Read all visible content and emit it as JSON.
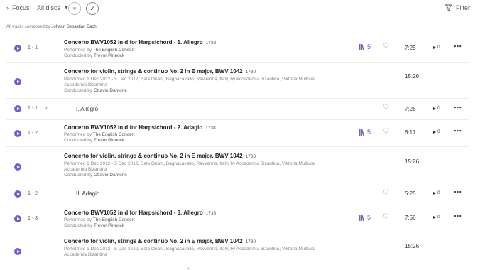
{
  "toolbar": {
    "focus_label": "Focus",
    "discs_label": "All discs",
    "filter_label": "Filter"
  },
  "composer_line": {
    "prefix": "All tracks composed by",
    "name": "Johann Sebastian Bach"
  },
  "tracks": [
    {
      "num": "1 - 1",
      "title": "Concerto BWV1052 in d for Harpsichord - 1. Allegro",
      "year": "1738",
      "performed_prefix": "Performed by",
      "performed": "The English Concert",
      "conducted_prefix": "Conducted by",
      "conducted": "Trevor Pinnock",
      "versions": "5",
      "duration": "7:25",
      "plays": "0"
    },
    {
      "title": "Concerto for violin, strings & continuo No. 2 in E major, BWV 1042",
      "year": "1730",
      "performed_line1": "Performed 1 Dec 2012 - 5 Dec 2012, Sala Oriani, Bagnacavallo, Ravvenna, Italy, by Accademia Bizantina, Viktoria Mullova,",
      "performed_line2": "Accademia Bizantina",
      "conducted_prefix": "Conducted by",
      "conducted": "Ottavio Dantone",
      "duration": "15:26"
    },
    {
      "num": "1 - 1",
      "check": "✓",
      "title": "I. Allegro",
      "duration": "7:26",
      "plays": "0"
    },
    {
      "num": "1 - 2",
      "title": "Concerto BWV1052 in d for Harpsichord - 2. Adagio",
      "year": "1738",
      "performed_prefix": "Performed by",
      "performed": "The English Concert",
      "conducted_prefix": "Conducted by",
      "conducted": "Trevor Pinnock",
      "versions": "5",
      "duration": "6:17",
      "plays": "0"
    },
    {
      "title": "Concerto for violin, strings & continuo No. 2 in E major, BWV 1042",
      "year": "1730",
      "performed_line1": "Performed 1 Dec 2012 - 5 Dec 2012, Sala Oriani, Bagnacavallo, Ravvenna, Italy, by Accademia Bizantina, Viktoria Mullova,",
      "performed_line2": "Accademia Bizantina",
      "conducted_prefix": "Conducted by",
      "conducted": "Ottavio Dantone",
      "duration": "15:26"
    },
    {
      "num": "1 - 2",
      "title": "II. Adagio",
      "duration": "5:25",
      "plays": "0"
    },
    {
      "num": "1 - 3",
      "title": "Concerto BWV1052 in d for Harpsichord - 3. Allegro",
      "year": "1738",
      "performed_prefix": "Performed by",
      "performed": "The English Concert",
      "conducted_prefix": "Conducted by",
      "conducted": "Trevor Pinnock",
      "versions": "5",
      "duration": "7:56",
      "plays": "0"
    },
    {
      "title": "Concerto for violin, strings & continuo No. 2 in E major, BWV 1042",
      "year": "1730",
      "performed_line1": "Performed 1 Dec 2012 - 5 Dec 2012, Sala Oriani, Bagnacavallo, Ravvenna, Italy, by Accademia Bizantina, Viktoria Mullova,",
      "performed_line2": "Accademia Bizantina",
      "duration": "15:26"
    }
  ],
  "colors": {
    "accent": "#6c63c9"
  }
}
